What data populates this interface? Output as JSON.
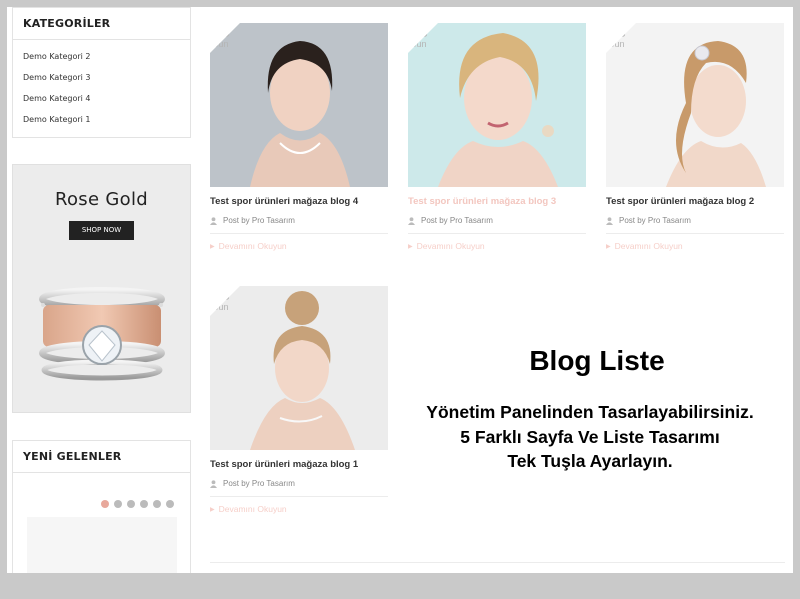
{
  "sidebar": {
    "categories": {
      "title": "KATEGORİLER",
      "items": [
        {
          "label": "Demo Kategori 2"
        },
        {
          "label": "Demo Kategori 3"
        },
        {
          "label": "Demo Kategori 4"
        },
        {
          "label": "Demo Kategori 1"
        }
      ]
    },
    "promo": {
      "title": "Rose Gold",
      "button": "SHOP NOW",
      "image_icon": "ring-image"
    },
    "new_arrivals": {
      "title": "YENİ GELENLER",
      "slides": 6,
      "active_slide": 1
    }
  },
  "posts": [
    {
      "day": "18",
      "month": "Jun",
      "title": "Test spor ürünleri mağaza blog 4",
      "author": "Post by Pro Tasarım",
      "read_more": "Devamını Okuyun",
      "title_style": "normal"
    },
    {
      "day": "18",
      "month": "Jun",
      "title": "Test spor ürünleri mağaza blog 3",
      "author": "Post by Pro Tasarım",
      "read_more": "Devamını Okuyun",
      "title_style": "faded"
    },
    {
      "day": "18",
      "month": "Jun",
      "title": "Test spor ürünleri mağaza blog 2",
      "author": "Post by Pro Tasarım",
      "read_more": "Devamını Okuyun",
      "title_style": "normal"
    },
    {
      "day": "18",
      "month": "Jun",
      "title": "Test spor ürünleri mağaza blog 1",
      "author": "Post by Pro Tasarım",
      "read_more": "Devamını Okuyun",
      "title_style": "normal"
    }
  ],
  "overlay": {
    "title": "Blog Liste",
    "line1": "Yönetim Panelinden Tasarlayabilirsiniz.",
    "line2": "5 Farklı Sayfa Ve Liste Tasarımı",
    "line3": "Tek Tuşla Ayarlayın."
  },
  "colors": {
    "accent_pink": "#f3c7c0",
    "dot_active": "#e8a89b",
    "button_dark": "#222222"
  }
}
